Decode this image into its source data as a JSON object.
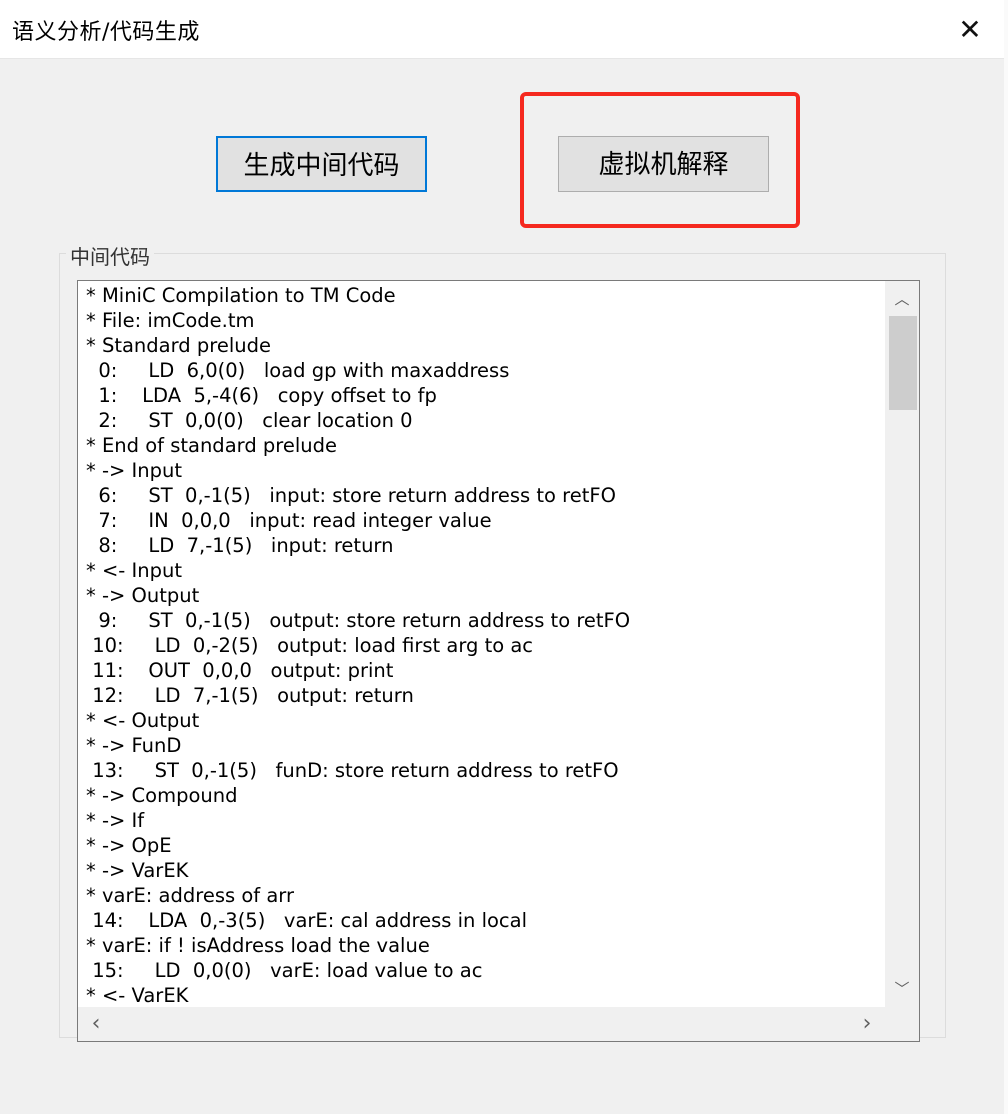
{
  "window": {
    "title": "语义分析/代码生成",
    "close_glyph": "✕"
  },
  "toolbar": {
    "generate_label": "生成中间代码",
    "vm_label": "虚拟机解释"
  },
  "group": {
    "label": "中间代码"
  },
  "code_lines": [
    "* MiniC Compilation to TM Code",
    "* File: imCode.tm",
    "* Standard prelude",
    "  0:     LD  6,0(0)   load gp with maxaddress",
    "  1:    LDA  5,-4(6)   copy offset to fp",
    "  2:     ST  0,0(0)   clear location 0",
    "* End of standard prelude",
    "* -> Input",
    "  6:     ST  0,-1(5)   input: store return address to retFO",
    "  7:     IN  0,0,0   input: read integer value",
    "  8:     LD  7,-1(5)   input: return",
    "* <- Input",
    "* -> Output",
    "  9:     ST  0,-1(5)   output: store return address to retFO",
    " 10:     LD  0,-2(5)   output: load first arg to ac",
    " 11:    OUT  0,0,0   output: print",
    " 12:     LD  7,-1(5)   output: return",
    "* <- Output",
    "* -> FunD",
    " 13:     ST  0,-1(5)   funD: store return address to retFO",
    "* -> Compound",
    "* -> If",
    "* -> OpE",
    "* -> VarEK",
    "* varE: address of arr",
    " 14:    LDA  0,-3(5)   varE: cal address in local",
    "* varE: if ! isAddress load the value",
    " 15:     LD  0,0(0)   varE: load value to ac",
    "* <- VarEK"
  ],
  "scrollbars": {
    "up_glyph": "︿",
    "down_glyph": "﹀",
    "left_glyph": "‹",
    "right_glyph": "›"
  },
  "colors": {
    "highlight": "#f5291f",
    "focus_border": "#0078d7"
  }
}
